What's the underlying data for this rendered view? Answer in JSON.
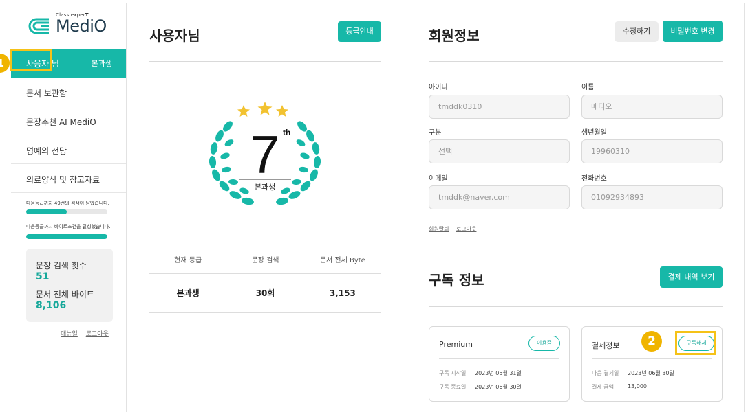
{
  "sidebar": {
    "logo_small_prefix": "Class exper",
    "logo_small_suffix": "T",
    "logo_main": "MediO",
    "active_item": {
      "label": "사용자 님",
      "sub_label": "본과생"
    },
    "items": [
      {
        "label": "문서 보관함"
      },
      {
        "label": "문장추천 AI MediO"
      },
      {
        "label": "명예의 전당"
      },
      {
        "label": "의료양식 및 참고자료"
      }
    ],
    "progress": [
      {
        "label": "다음등급까지 49번의 검색이 남았습니다.",
        "fraction": 0.5
      },
      {
        "label": "다음등급까지 바이트조건을 달성했습니다.",
        "fraction": 1.0
      }
    ],
    "stats": {
      "search_count_label": "문장 검색 횟수",
      "search_count_value": "51",
      "bytes_label": "문서 전체 바이트",
      "bytes_value": "8,106"
    },
    "links": {
      "manual": "매뉴얼",
      "logout": "로그아웃"
    },
    "badge": "1"
  },
  "profile": {
    "title": "사용자님",
    "grade_guide_button": "등급안내",
    "emblem_number": "7",
    "emblem_suffix": "th",
    "emblem_label": "본과생",
    "table": {
      "headers": [
        "현재 등급",
        "문장 검색",
        "문서 전체 Byte"
      ],
      "values": [
        "본과생",
        "30회",
        "3,153"
      ]
    }
  },
  "member": {
    "title": "회원정보",
    "edit_button": "수정하기",
    "password_button": "비밀번호 변경",
    "fields": {
      "id": {
        "label": "아이디",
        "value": "tmddk0310"
      },
      "name": {
        "label": "이름",
        "value": "메디오"
      },
      "category": {
        "label": "구분",
        "value": "선택"
      },
      "birth": {
        "label": "생년월일",
        "value": "19960310"
      },
      "email": {
        "label": "이메일",
        "value": "tmddk@naver.com"
      },
      "phone": {
        "label": "전화번호",
        "value": "01092934893"
      }
    },
    "links": {
      "withdraw": "회원탈퇴",
      "logout": "로그아웃"
    }
  },
  "subscription": {
    "title": "구독 정보",
    "history_button": "결제 내역 보기",
    "plan_card": {
      "title": "Premium",
      "status_pill": "이용중",
      "start_label": "구독 시작일",
      "start_value": "2023년 05월 31일",
      "end_label": "구독 종료일",
      "end_value": "2023년 06월 30일"
    },
    "payment_card": {
      "title": "결제정보",
      "cancel_pill": "구독해제",
      "next_label": "다음 결제일",
      "next_value": "2023년 06월 30일",
      "amount_label": "결제 금액",
      "amount_value": "13,000"
    },
    "badge": "2"
  },
  "colors": {
    "accent": "#17b8a8",
    "highlight": "#f5c218",
    "badge": "#f0b400"
  }
}
